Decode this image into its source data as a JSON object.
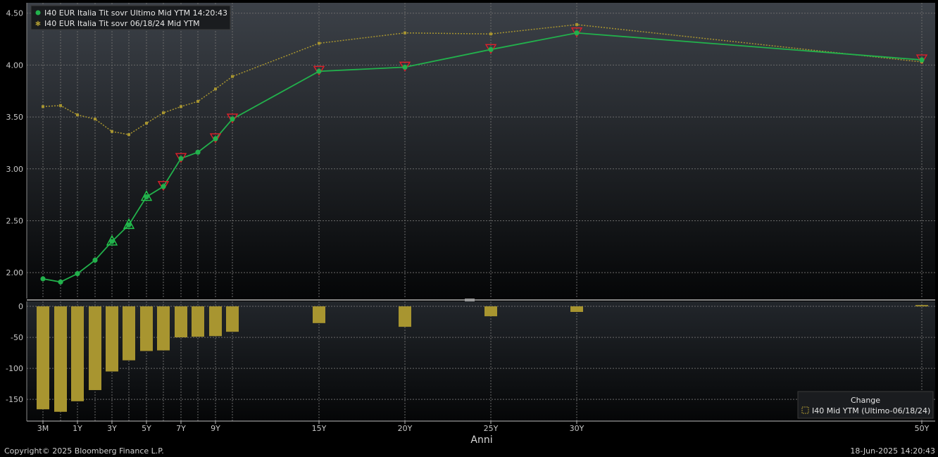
{
  "chart_data": [
    {
      "type": "line",
      "panel": "top",
      "x_categories": [
        "3M",
        "6M",
        "1Y",
        "2Y",
        "3Y",
        "4Y",
        "5Y",
        "6Y",
        "7Y",
        "8Y",
        "9Y",
        "10Y",
        "15Y",
        "20Y",
        "25Y",
        "30Y",
        "50Y"
      ],
      "series": [
        {
          "name": "I40 EUR Italia Tit sovr Ultimo Mid YTM 14:20:43",
          "color": "#22b14c",
          "values": [
            1.94,
            1.91,
            1.99,
            2.12,
            2.3,
            2.46,
            2.73,
            2.83,
            3.1,
            3.16,
            3.29,
            3.48,
            3.94,
            3.98,
            4.15,
            4.31,
            4.05
          ]
        },
        {
          "name": "I40 EUR Italia Tit sovr 06/18/24 Mid YTM",
          "color": "#a89530",
          "values": [
            3.6,
            3.61,
            3.52,
            3.48,
            3.36,
            3.33,
            3.44,
            3.54,
            3.6,
            3.65,
            3.77,
            3.89,
            4.21,
            4.31,
            4.3,
            4.39,
            4.03
          ]
        }
      ],
      "markers": {
        "up_triangle": [
          "3Y",
          "4Y",
          "5Y"
        ],
        "down_triangle": [
          "6Y",
          "7Y",
          "9Y",
          "10Y",
          "15Y",
          "20Y",
          "25Y",
          "30Y",
          "50Y"
        ]
      },
      "ylim": [
        1.75,
        4.6
      ],
      "yticks": [
        "2.00",
        "2.50",
        "3.00",
        "3.50",
        "4.00",
        "4.50"
      ],
      "grid": true,
      "legend_position": "top-left"
    },
    {
      "type": "bar",
      "panel": "bottom",
      "x_categories": [
        "3M",
        "6M",
        "1Y",
        "2Y",
        "3Y",
        "4Y",
        "5Y",
        "6Y",
        "7Y",
        "8Y",
        "9Y",
        "10Y",
        "15Y",
        "20Y",
        "25Y",
        "30Y",
        "50Y"
      ],
      "series": [
        {
          "name": "I40 Mid YTM (Ultimo-06/18/24)",
          "color": "#a89530",
          "values": [
            -166,
            -170,
            -153,
            -135,
            -105,
            -87,
            -72,
            -71,
            -50,
            -49,
            -48,
            -41,
            -27,
            -33,
            -16,
            -9,
            2
          ]
        }
      ],
      "ylim": [
        -185,
        8
      ],
      "yticks": [
        "0",
        "-50",
        "-100",
        "-150"
      ],
      "legend_title": "Change",
      "legend_position": "bottom-right"
    }
  ],
  "x_axis": {
    "tick_labels": [
      {
        "cat": "3M",
        "label": "3M"
      },
      {
        "cat": "1Y",
        "label": "1Y"
      },
      {
        "cat": "3Y",
        "label": "3Y"
      },
      {
        "cat": "5Y",
        "label": "5Y"
      },
      {
        "cat": "7Y",
        "label": "7Y"
      },
      {
        "cat": "9Y",
        "label": "9Y"
      },
      {
        "cat": "15Y",
        "label": "15Y"
      },
      {
        "cat": "20Y",
        "label": "20Y"
      },
      {
        "cat": "25Y",
        "label": "25Y"
      },
      {
        "cat": "30Y",
        "label": "30Y"
      },
      {
        "cat": "50Y",
        "label": "50Y"
      }
    ],
    "title": "Anni"
  },
  "footer": {
    "copyright": "Copyright© 2025 Bloomberg Finance L.P.",
    "timestamp": "18-Jun-2025 14:20:43"
  },
  "colors": {
    "background": "#000000",
    "grid": "#6a6a6a",
    "current": "#22b14c",
    "previous": "#a89530",
    "bar": "#a89530",
    "down_marker": "#e0202a",
    "up_marker": "#22c84c"
  }
}
